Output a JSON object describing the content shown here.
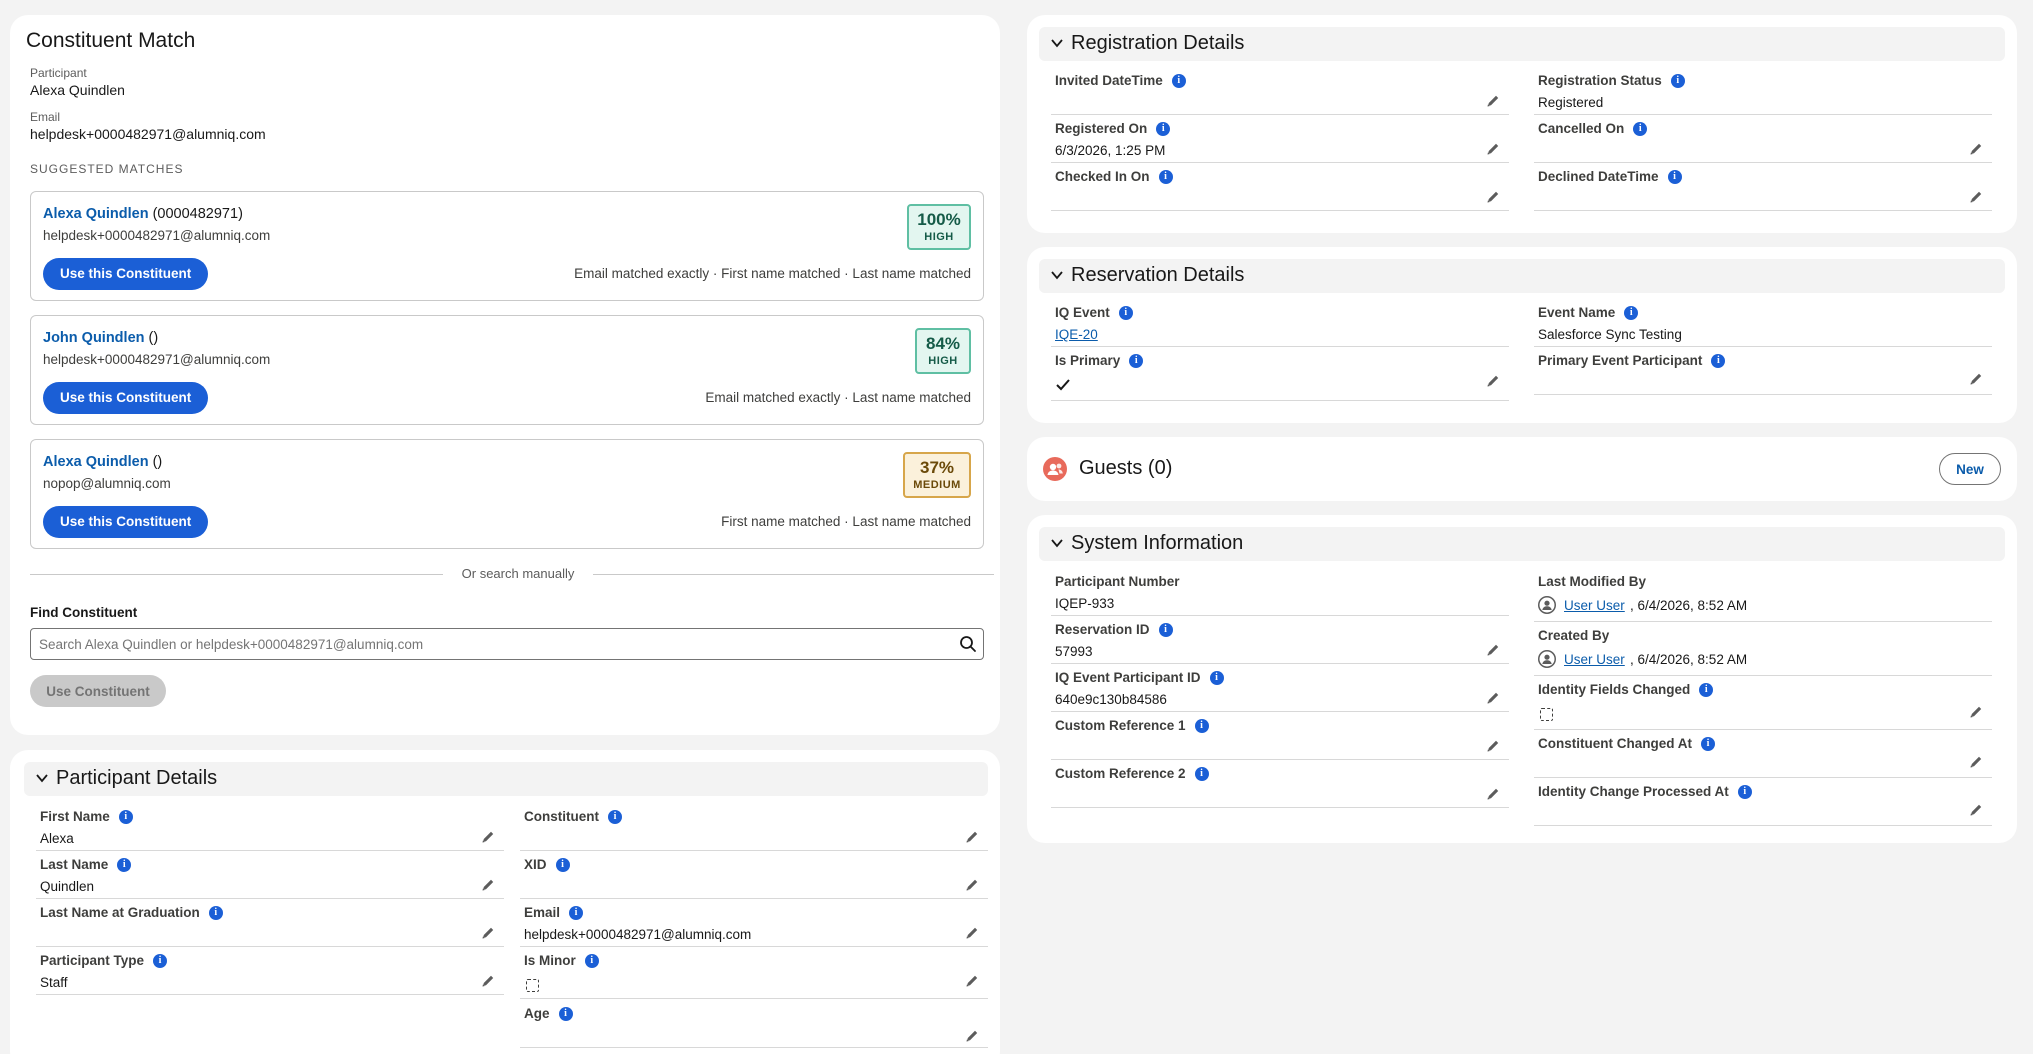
{
  "constituent_match": {
    "title": "Constituent Match",
    "participant_label": "Participant",
    "participant_value": "Alexa Quindlen",
    "email_label": "Email",
    "email_value": "helpdesk+0000482971@alumniq.com",
    "suggested_label": "SUGGESTED MATCHES",
    "matches": [
      {
        "name": "Alexa Quindlen",
        "id": "(0000482971)",
        "email": "helpdesk+0000482971@alumniq.com",
        "button": "Use this Constituent",
        "reasons": "Email matched exactly · First name matched · Last name matched",
        "score": "100%",
        "level": "HIGH"
      },
      {
        "name": "John Quindlen",
        "id": "()",
        "email": "helpdesk+0000482971@alumniq.com",
        "button": "Use this Constituent",
        "reasons": "Email matched exactly · Last name matched",
        "score": "84%",
        "level": "HIGH"
      },
      {
        "name": "Alexa Quindlen",
        "id": "()",
        "email": "nopop@alumniq.com",
        "button": "Use this Constituent",
        "reasons": "First name matched · Last name matched",
        "score": "37%",
        "level": "MEDIUM"
      }
    ],
    "divider_text": "Or search manually",
    "find_label": "Find Constituent",
    "search_placeholder": "Search Alexa Quindlen or helpdesk+0000482971@alumniq.com",
    "use_button": "Use Constituent"
  },
  "participant_details": {
    "title": "Participant Details",
    "fields": {
      "first_name": {
        "label": "First Name",
        "value": "Alexa"
      },
      "last_name": {
        "label": "Last Name",
        "value": "Quindlen"
      },
      "last_name_grad": {
        "label": "Last Name at Graduation",
        "value": ""
      },
      "participant_type": {
        "label": "Participant Type",
        "value": "Staff"
      },
      "constituent": {
        "label": "Constituent",
        "value": ""
      },
      "xid": {
        "label": "XID",
        "value": ""
      },
      "email": {
        "label": "Email",
        "value": "helpdesk+0000482971@alumniq.com"
      },
      "is_minor": {
        "label": "Is Minor",
        "value": ""
      },
      "age": {
        "label": "Age",
        "value": ""
      }
    }
  },
  "registration_details": {
    "title": "Registration Details",
    "fields": {
      "invited": {
        "label": "Invited DateTime",
        "value": ""
      },
      "status": {
        "label": "Registration Status",
        "value": "Registered"
      },
      "registered_on": {
        "label": "Registered On",
        "value": "6/3/2026, 1:25 PM"
      },
      "cancelled_on": {
        "label": "Cancelled On",
        "value": ""
      },
      "checked_in": {
        "label": "Checked In On",
        "value": ""
      },
      "declined": {
        "label": "Declined DateTime",
        "value": ""
      }
    }
  },
  "reservation_details": {
    "title": "Reservation Details",
    "fields": {
      "iq_event": {
        "label": "IQ Event",
        "value": "IQE-20"
      },
      "event_name": {
        "label": "Event Name",
        "value": "Salesforce Sync Testing"
      },
      "is_primary": {
        "label": "Is Primary",
        "value": ""
      },
      "primary_participant": {
        "label": "Primary Event Participant",
        "value": ""
      }
    }
  },
  "guests": {
    "title": "Guests (0)",
    "new_button": "New"
  },
  "system_information": {
    "title": "System Information",
    "fields": {
      "participant_number": {
        "label": "Participant Number",
        "value": "IQEP-933"
      },
      "last_modified": {
        "label": "Last Modified By",
        "user": "User User",
        "date": ", 6/4/2026, 8:52 AM"
      },
      "reservation_id": {
        "label": "Reservation ID",
        "value": "57993"
      },
      "created_by": {
        "label": "Created By",
        "user": "User User",
        "date": ", 6/4/2026, 8:52 AM"
      },
      "iq_event_participant_id": {
        "label": "IQ Event Participant ID",
        "value": "640e9c130b84586"
      },
      "identity_fields_changed": {
        "label": "Identity Fields Changed",
        "value": ""
      },
      "custom_ref_1": {
        "label": "Custom Reference 1",
        "value": ""
      },
      "constituent_changed_at": {
        "label": "Constituent Changed At",
        "value": ""
      },
      "custom_ref_2": {
        "label": "Custom Reference 2",
        "value": ""
      },
      "identity_change_processed": {
        "label": "Identity Change Processed At",
        "value": ""
      }
    }
  },
  "colors": {
    "brand_blue": "#1b5fd6",
    "link": "#0b5cab",
    "high": "#5fbfa3",
    "medium": "#d7a64a",
    "guests_icon": "#e86a5b"
  },
  "icons": {
    "info": "info-icon",
    "edit": "pencil-icon",
    "collapse": "chevron-down-icon",
    "search": "search-icon",
    "guests": "guests-icon",
    "avatar": "user-avatar-icon",
    "check": "checkmark-icon"
  }
}
